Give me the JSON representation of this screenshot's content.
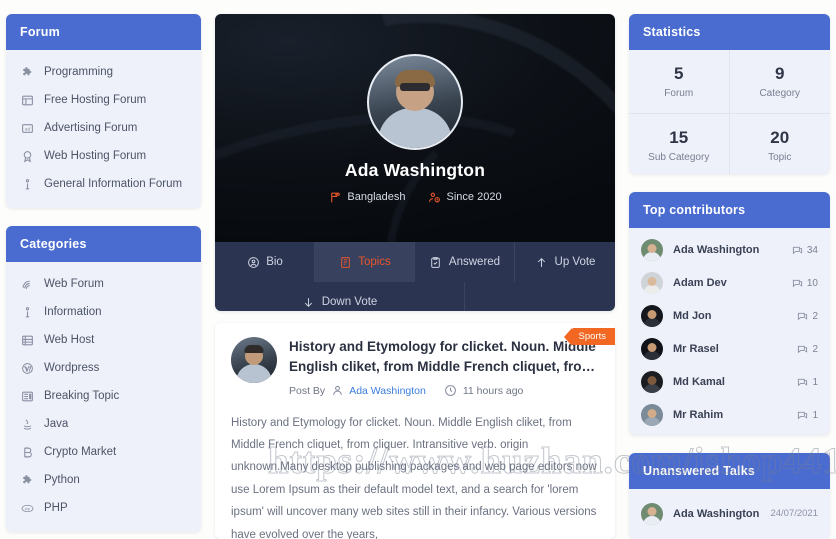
{
  "forum_panel": {
    "title": "Forum",
    "items": [
      {
        "label": "Programming",
        "icon": "puzzle-icon"
      },
      {
        "label": "Free Hosting Forum",
        "icon": "table-icon"
      },
      {
        "label": "Advertising Forum",
        "icon": "ad-icon"
      },
      {
        "label": "Web Hosting Forum",
        "icon": "badge-icon"
      },
      {
        "label": "General Information Forum",
        "icon": "info-icon"
      }
    ]
  },
  "categories_panel": {
    "title": "Categories",
    "items": [
      {
        "label": "Web Forum",
        "icon": "signal-icon"
      },
      {
        "label": "Information",
        "icon": "info-icon"
      },
      {
        "label": "Web Host",
        "icon": "server-icon"
      },
      {
        "label": "Wordpress",
        "icon": "wordpress-icon"
      },
      {
        "label": "Breaking Topic",
        "icon": "news-icon"
      },
      {
        "label": "Java",
        "icon": "java-icon"
      },
      {
        "label": "Crypto Market",
        "icon": "bitcoin-icon"
      },
      {
        "label": "Python",
        "icon": "python-icon"
      },
      {
        "label": "PHP",
        "icon": "php-icon"
      }
    ]
  },
  "profile": {
    "name": "Ada Washington",
    "country": "Bangladesh",
    "country_icon": "flag-icon",
    "since": "Since 2020",
    "since_icon": "user-clock-icon",
    "tabs": [
      {
        "label": "Bio",
        "icon": "user-circle-icon",
        "active": false
      },
      {
        "label": "Topics",
        "icon": "book-icon",
        "active": true
      },
      {
        "label": "Answered",
        "icon": "clipboard-check-icon",
        "active": false
      },
      {
        "label": "Up Vote",
        "icon": "arrow-up-icon",
        "active": false
      },
      {
        "label": "Down Vote",
        "icon": "arrow-down-icon",
        "active": false
      }
    ]
  },
  "post": {
    "badge": "Sports",
    "title": "History and Etymology for clicket. Noun. Middle English cliket, from Middle French cliquet, fro…",
    "post_by_label": "Post By",
    "author": "Ada Washington",
    "author_icon": "user-icon",
    "time_icon": "clock-icon",
    "time": "11 hours ago",
    "body": "History and Etymology for clicket. Noun. Middle English cliket, from Middle French cliquet, from cliquer. Intransitive verb. origin unknown.Many desktop publishing packages and web page editors now use Lorem Ipsum as their default model text, and a search for 'lorem ipsum' will uncover many web sites still in their infancy. Various versions have evolved over the years,"
  },
  "statistics": {
    "title": "Statistics",
    "items": [
      {
        "value": "5",
        "label": "Forum"
      },
      {
        "value": "9",
        "label": "Category"
      },
      {
        "value": "15",
        "label": "Sub Category"
      },
      {
        "value": "20",
        "label": "Topic"
      }
    ]
  },
  "top_contributors": {
    "title": "Top contributors",
    "count_icon": "comment-icon",
    "items": [
      {
        "name": "Ada Washington",
        "count": "34",
        "face": "#d6b292",
        "body": "#e9eef5",
        "bg": "#6f8c70"
      },
      {
        "name": "Adam Dev",
        "count": "10",
        "face": "#d9bb9c",
        "body": "#ececec",
        "bg": "#cfd4d8"
      },
      {
        "name": "Md Jon",
        "count": "2",
        "face": "#c79a74",
        "body": "#2a2f38",
        "bg": "#14171c"
      },
      {
        "name": "Mr Rasel",
        "count": "2",
        "face": "#c79a74",
        "body": "#2b3038",
        "bg": "#101317"
      },
      {
        "name": "Md Kamal",
        "count": "1",
        "face": "#7d5a3e",
        "body": "#3a3f47",
        "bg": "#1b1d21"
      },
      {
        "name": "Mr Rahim",
        "count": "1",
        "face": "#d2ab88",
        "body": "#9aa7b5",
        "bg": "#7b8a99"
      }
    ]
  },
  "unanswered_talks": {
    "title": "Unanswered Talks",
    "items": [
      {
        "name": "Ada Washington",
        "date": "24/07/2021",
        "face": "#d6b292",
        "body": "#e9eef5",
        "bg": "#6f8c70"
      }
    ]
  },
  "watermark": "https://www.huzhan.com/ishop44157",
  "colors": {
    "accent_blue": "#4a6bd0",
    "accent_orange": "#e8552a",
    "card_bg": "#eef1fa",
    "page_bg": "#fdfdfb",
    "tabbar_bg": "#2b3450"
  }
}
